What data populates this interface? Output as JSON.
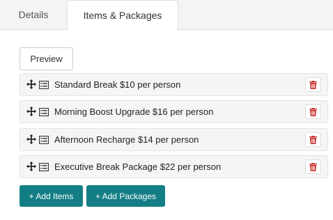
{
  "tabs": [
    {
      "label": "Details"
    },
    {
      "label": "Items & Packages",
      "active": true
    }
  ],
  "preview": {
    "label": "Preview"
  },
  "items": [
    {
      "label": "Standard Break $10 per person"
    },
    {
      "label": "Morning Boost Upgrade $16 per person"
    },
    {
      "label": "Afternoon Recharge $14 per person"
    },
    {
      "label": "Executive Break Package $22 per person"
    }
  ],
  "actions": {
    "add_items": "+ Add Items",
    "add_packages": "+ Add Packages"
  },
  "colors": {
    "primary": "#137f85",
    "danger": "#c9302c"
  },
  "icons": {
    "drag": "move-icon",
    "item_type": "list-icon",
    "delete": "trash-icon"
  }
}
